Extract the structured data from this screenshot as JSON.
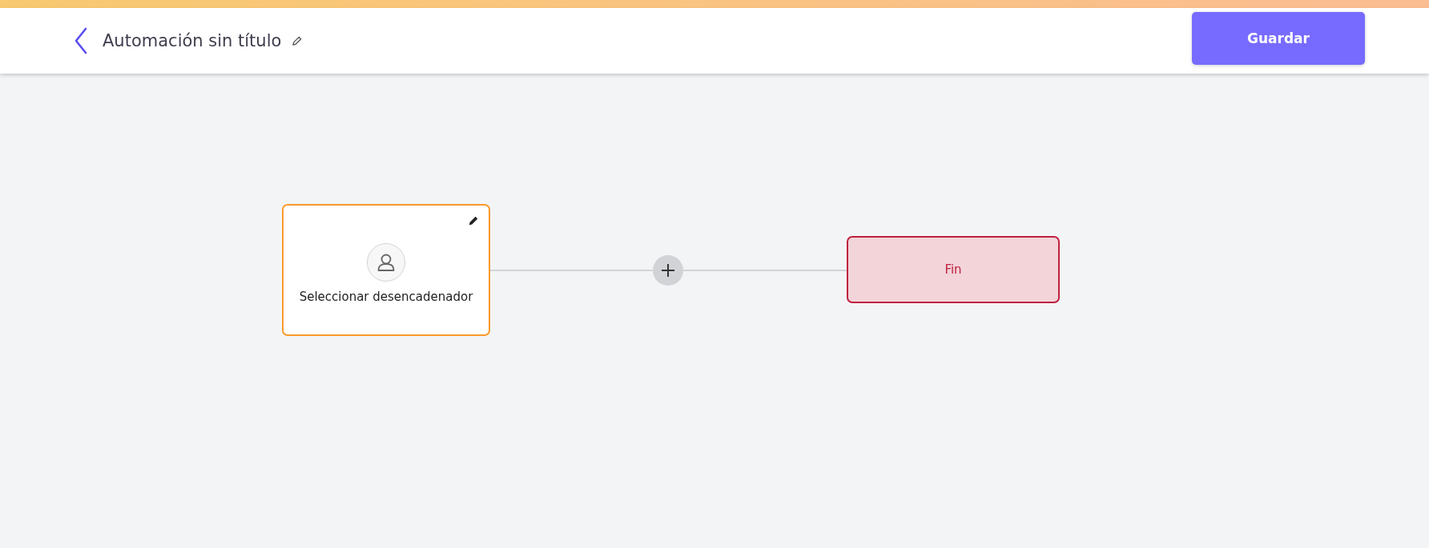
{
  "header": {
    "title": "Automación sin título",
    "save_button": "Guardar"
  },
  "nodes": [
    {
      "kind": "trigger",
      "label": "Seleccionar desencadenador"
    },
    {
      "kind": "end",
      "label": "Fin"
    }
  ]
}
